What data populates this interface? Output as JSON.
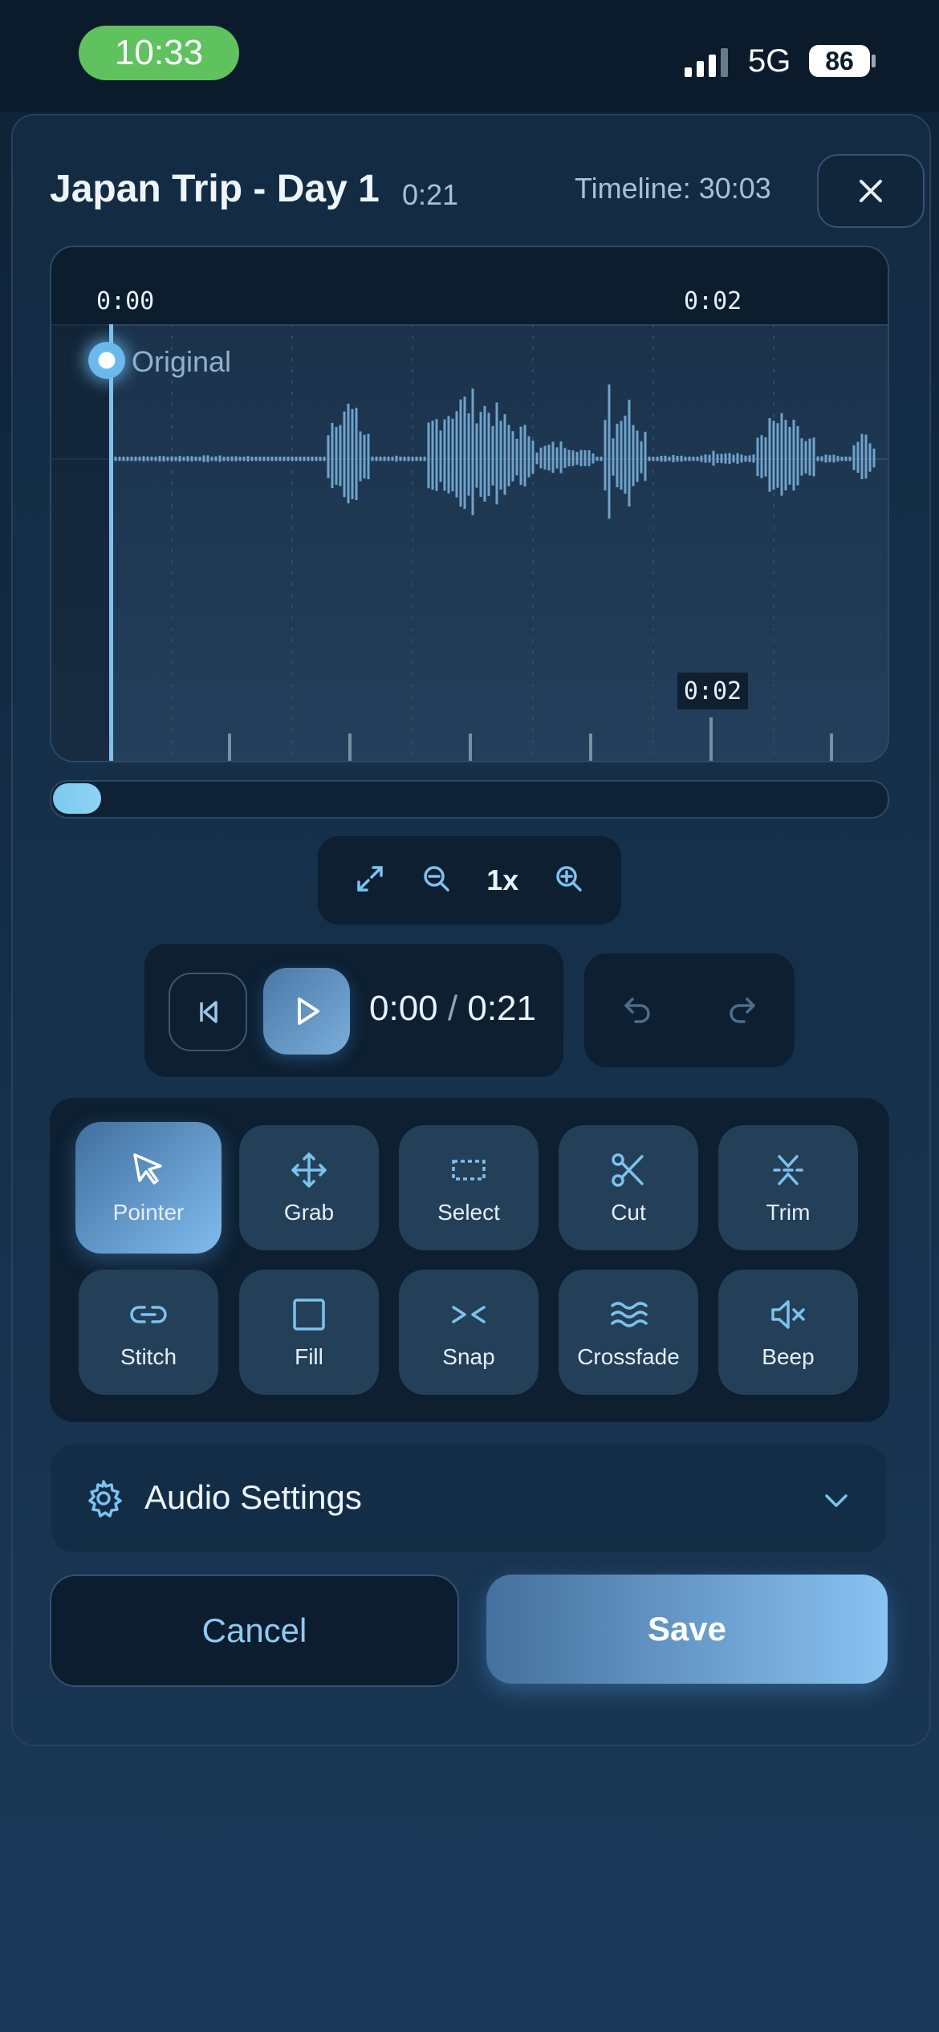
{
  "status_bar": {
    "time": "10:33",
    "network": "5G",
    "battery": "86"
  },
  "editor": {
    "title": "Japan Trip - Day 1",
    "duration": "0:21",
    "timeline_label": "Timeline: 30:03"
  },
  "waveform": {
    "ruler_times": [
      "0:00",
      "0:02"
    ],
    "track_label": "Original",
    "hover_time": "0:02",
    "scrub_progress": 0.0
  },
  "zoom": {
    "level": "1x"
  },
  "playback": {
    "current": "0:00",
    "separator": "/",
    "total": "0:21"
  },
  "tools": [
    {
      "label": "Pointer",
      "icon": "pointer-icon",
      "active": true
    },
    {
      "label": "Grab",
      "icon": "move-icon",
      "active": false
    },
    {
      "label": "Select",
      "icon": "select-icon",
      "active": false
    },
    {
      "label": "Cut",
      "icon": "scissors-icon",
      "active": false
    },
    {
      "label": "Trim",
      "icon": "trim-icon",
      "active": false
    },
    {
      "label": "Stitch",
      "icon": "link-icon",
      "active": false
    },
    {
      "label": "Fill",
      "icon": "square-icon",
      "active": false
    },
    {
      "label": "Snap",
      "icon": "snap-icon",
      "active": false
    },
    {
      "label": "Crossfade",
      "icon": "waves-icon",
      "active": false
    },
    {
      "label": "Beep",
      "icon": "mute-icon",
      "active": false
    }
  ],
  "settings": {
    "label": "Audio Settings"
  },
  "actions": {
    "cancel": "Cancel",
    "save": "Save"
  },
  "colors": {
    "accent": "#7cc2ef",
    "active_tool": "#82bbee",
    "time_pill": "#5fc25f"
  }
}
